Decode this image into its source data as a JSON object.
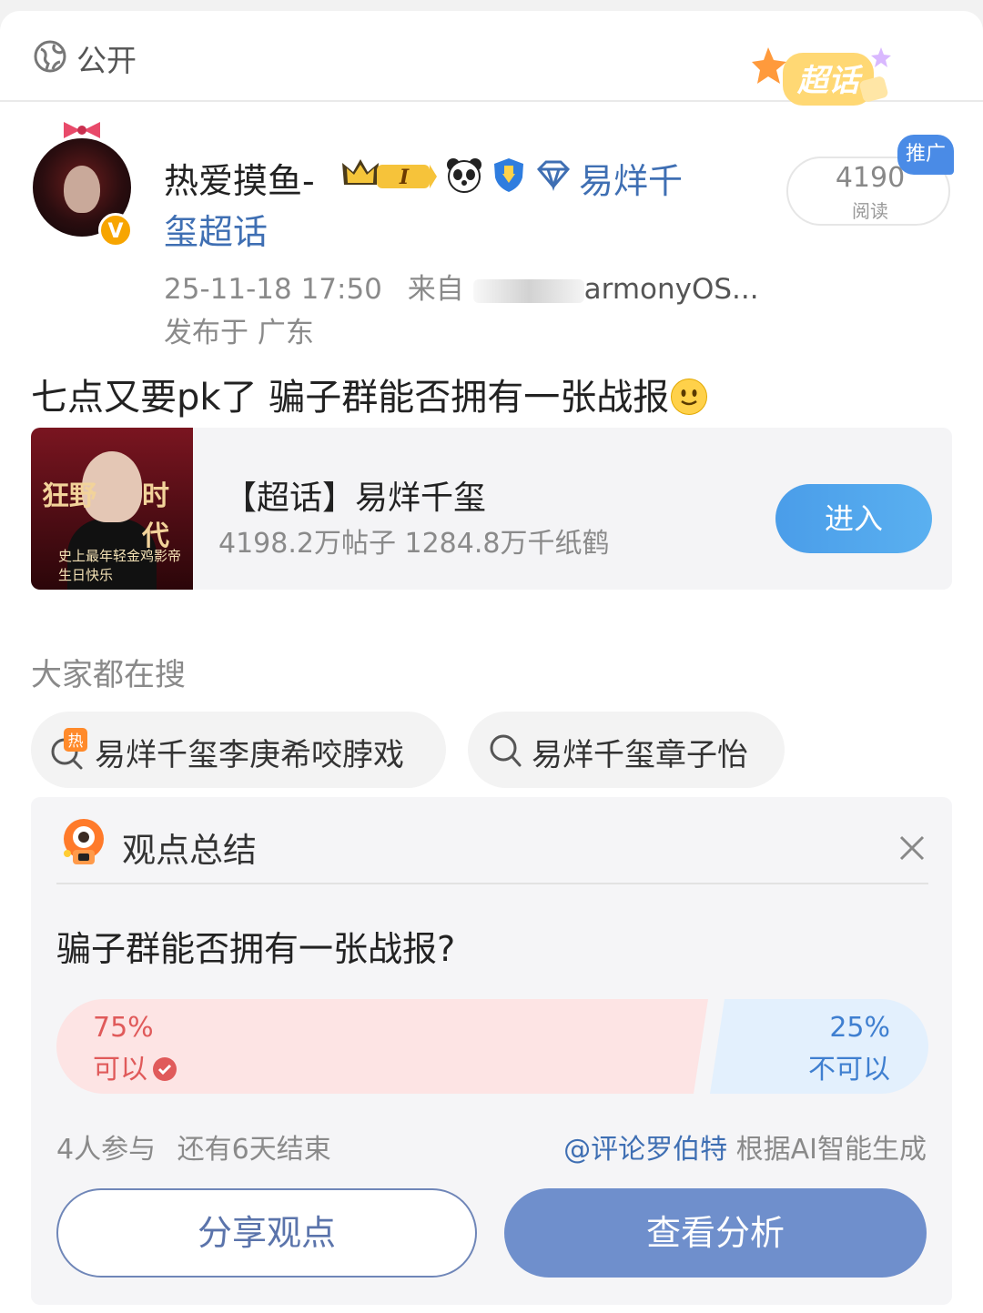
{
  "header": {
    "visibility_label": "公开",
    "supertopic_badge": "超话"
  },
  "post": {
    "username": "热爱摸鱼-",
    "level_badge": "I",
    "topic_part1": "易烊千",
    "topic_part2": "玺超话",
    "timestamp": "25-11-18 17:50",
    "source_prefix": "来自",
    "source_suffix": "armonyOS...",
    "location": "发布于 广东",
    "reads_count": "4190",
    "reads_label": "阅读",
    "promo_tag": "推广",
    "content": "七点又要pk了 骗子群能否拥有一张战报"
  },
  "topic_card": {
    "title": "【超话】易烊千玺",
    "stats": "4198.2万帖子 1284.8万千纸鹤",
    "enter_label": "进入",
    "thumb_left": "狂野",
    "thumb_right": "时代",
    "thumb_bottom": "史上最年轻金鸡影帝 生日快乐"
  },
  "search": {
    "heading": "大家都在搜",
    "chips": [
      {
        "label": "易烊千玺李庚希咬脖戏",
        "icon": "hot-search-icon",
        "hot_char": "热"
      },
      {
        "label": "易烊千玺章子怡",
        "icon": "search-icon"
      }
    ]
  },
  "opinion": {
    "title": "观点总结",
    "question": "骗子群能否拥有一张战报?",
    "yes_percent": "75%",
    "yes_label": "可以",
    "no_percent": "25%",
    "no_label": "不可以",
    "participants": "4人参与",
    "remaining": "还有6天结束",
    "source_link": "@评论罗伯特",
    "source_text": " 根据AI智能生成",
    "share_label": "分享观点",
    "analysis_label": "查看分析",
    "yes_fraction": 0.75,
    "no_fraction": 0.25
  },
  "colors": {
    "link": "#3f6fb3",
    "enter_button": "#4a9de9",
    "yes_bar": "#fde4e4",
    "no_bar": "#e3f0fd",
    "analysis_button": "#6f8fcc"
  }
}
